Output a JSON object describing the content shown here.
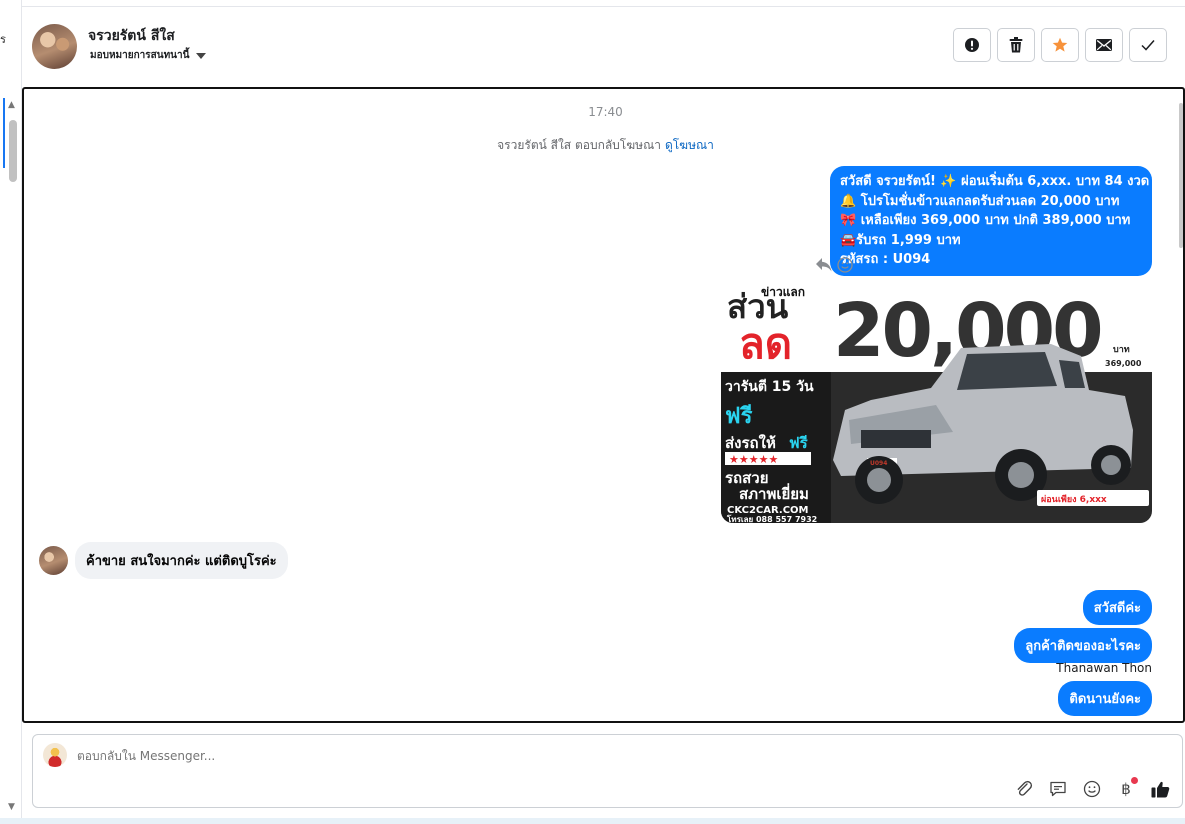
{
  "sidebar": {
    "partial_char": "ร"
  },
  "header": {
    "contact_name": "จรวยรัตน์ สีใส",
    "assign_label": "มอบหมายการสนทนานี้",
    "actions": [
      {
        "name": "spam-button",
        "icon": "alert-circle-icon"
      },
      {
        "name": "delete-button",
        "icon": "trash-icon"
      },
      {
        "name": "star-button",
        "icon": "star-icon"
      },
      {
        "name": "mark-unread-button",
        "icon": "envelope-icon"
      },
      {
        "name": "done-button",
        "icon": "check-icon"
      }
    ]
  },
  "chat": {
    "timestamp": "17:40",
    "ad_reply_note": "จรวยรัตน์ สีใส ตอบกลับโฆษณา",
    "ad_link": "ดูโฆษณา",
    "ad_message_lines": [
      "สวัสดี จรวยรัตน์! ✨ ผ่อนเริ่มต้น 6,xxx. บาท 84 งวด",
      "🔔 โปรโมชั่นข้าวแลกลดรับส่วนลด 20,000 บาท",
      "🎀 เหลือเพียง 369,000 บาท ปกติ 389,000 บาท",
      "🚘รับรถ 1,999 บาท",
      "รหัสรถ : U094"
    ],
    "ad_image": {
      "top_small": "ข่าวแลก",
      "big1": "ส่วน",
      "big2": "ลด",
      "amount": "20,000",
      "unit": "บาท",
      "price_small": "369,000",
      "warranty": "วารันตี 15 วัน",
      "free1": "ฟรี",
      "deliver": "ส่งรถให้",
      "free2": "ฟรี",
      "stars": "★★★★★",
      "nice": "รถสวย",
      "condition": "สภาพเยี่ยม",
      "site": "CKC2CAR.COM",
      "phone": "โทรเลย 088 557 7932",
      "installment": "ผ่อนเพียง 6,xxx",
      "plate": "U094"
    },
    "incoming_message": "ค้าขาย สนใจมากค่ะ แต่ติดบูโรค่ะ",
    "outgoing": [
      "สวัสดีค่ะ",
      "ลูกค้าติดของอะไรคะ",
      "ติดนานยังคะ"
    ],
    "sender_name": "Thanawan Thon"
  },
  "composer": {
    "placeholder": "ตอบกลับใน Messenger...",
    "currency_symbol": "฿"
  },
  "colors": {
    "accent": "#0a7cff",
    "star": "#f7923b",
    "link": "#0a66c2"
  }
}
